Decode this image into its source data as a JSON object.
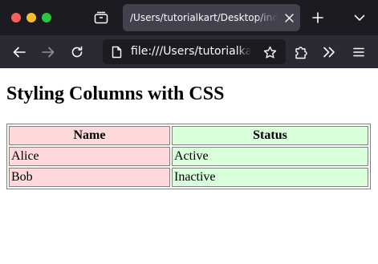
{
  "browser": {
    "tab": {
      "title": "/Users/tutorialkart/Desktop/index.html"
    },
    "url": "file:///Users/tutorialkart/Desktop/index.html",
    "icons": {
      "close": "close-icon",
      "minimize": "minimize-icon",
      "zoom": "zoom-icon",
      "tab_overview": "tab-overview-icon",
      "tab_close": "close-icon",
      "new_tab": "plus-icon",
      "tab_list": "chevron-down-icon",
      "back": "back-arrow-icon",
      "forward": "forward-arrow-icon",
      "reload": "reload-icon",
      "page": "page-icon",
      "bookmark": "star-icon",
      "extensions": "puzzle-icon",
      "overflow": "double-chevron-icon",
      "menu": "hamburger-menu-icon"
    }
  },
  "page": {
    "heading": "Styling Columns with CSS",
    "table": {
      "headers": [
        "Name",
        "Status"
      ],
      "rows": [
        [
          "Alice",
          "Active"
        ],
        [
          "Bob",
          "Inactive"
        ]
      ],
      "column_colors": [
        "#ffd9da",
        "#d8ffd9"
      ]
    }
  },
  "colors": {
    "tab_bar": "#1c1b22",
    "nav_bar": "#2b2a33",
    "active_tab": "#42414d",
    "traffic_red": "#ff5f57",
    "traffic_yellow": "#febc2e",
    "traffic_green": "#28c840"
  }
}
